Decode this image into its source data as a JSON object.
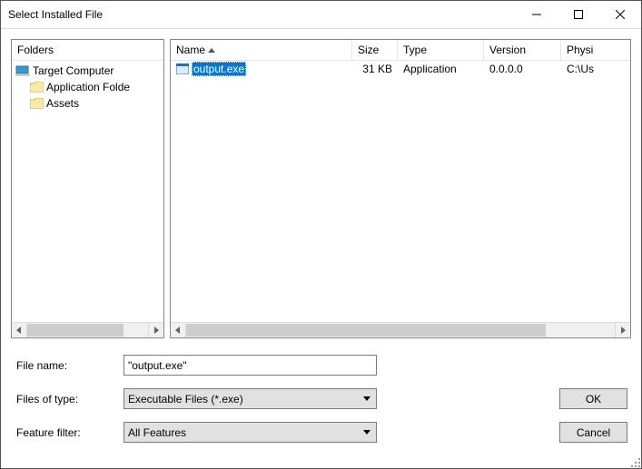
{
  "window": {
    "title": "Select Installed File"
  },
  "tree": {
    "header": "Folders",
    "root": "Target Computer",
    "items": [
      "Application Folde",
      "Assets"
    ]
  },
  "list": {
    "columns": {
      "name": "Name",
      "size": "Size",
      "type": "Type",
      "version": "Version",
      "physical": "Physi"
    },
    "rows": [
      {
        "name": "output.exe",
        "size": "31 KB",
        "type": "Application",
        "version": "0.0.0.0",
        "physical": "C:\\Us"
      }
    ]
  },
  "form": {
    "filename_label": "File name:",
    "filename_value": "\"output.exe\"",
    "filetype_label": "Files of type:",
    "filetype_value": "Executable Files (*.exe)",
    "feature_label": "Feature filter:",
    "feature_value": "All Features"
  },
  "buttons": {
    "ok": "OK",
    "cancel": "Cancel"
  }
}
